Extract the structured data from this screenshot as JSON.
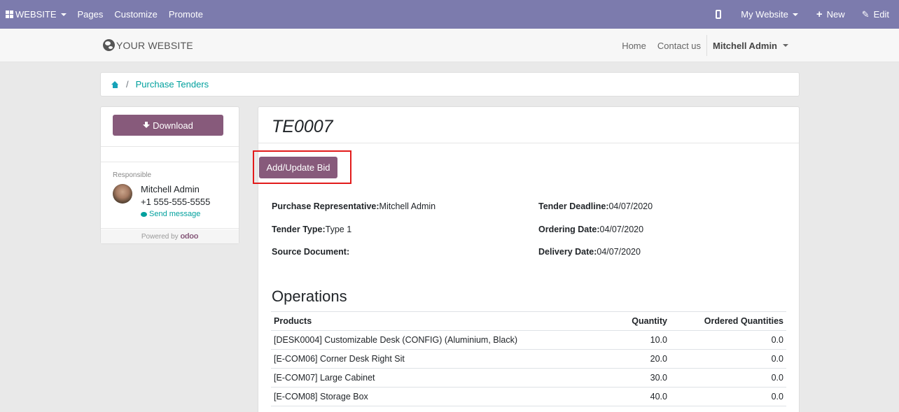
{
  "topbar": {
    "website_menu": "WEBSITE",
    "pages": "Pages",
    "customize": "Customize",
    "promote": "Promote",
    "website_selector": "My Website",
    "new": "New",
    "edit": "Edit"
  },
  "header": {
    "logo_text": "YOUR WEBSITE",
    "nav": [
      "Home",
      "Contact us"
    ],
    "user": "Mitchell Admin"
  },
  "breadcrumb": {
    "separator": "/",
    "current": "Purchase Tenders"
  },
  "sidebar": {
    "download": "Download",
    "responsible_label": "Responsible",
    "responsible_name": "Mitchell Admin",
    "responsible_phone": "+1 555-555-5555",
    "send_message": "Send message",
    "powered_by": "Powered by",
    "odoo": "odoo"
  },
  "tender": {
    "title": "TE0007",
    "bid_button": "Add/Update Bid",
    "fields": {
      "purchase_rep_label": "Purchase Representative:",
      "purchase_rep_value": "Mitchell Admin",
      "tender_type_label": "Tender Type:",
      "tender_type_value": "Type 1",
      "source_doc_label": "Source Document:",
      "source_doc_value": "",
      "deadline_label": "Tender Deadline:",
      "deadline_value": "04/07/2020",
      "ordering_label": "Ordering Date:",
      "ordering_value": "04/07/2020",
      "delivery_label": "Delivery Date:",
      "delivery_value": "04/07/2020"
    }
  },
  "operations": {
    "title": "Operations",
    "columns": [
      "Products",
      "Quantity",
      "Ordered Quantities"
    ],
    "rows": [
      [
        "[DESK0004] Customizable Desk (CONFIG) (Aluminium, Black)",
        "10.0",
        "0.0"
      ],
      [
        "[E-COM06] Corner Desk Right Sit",
        "20.0",
        "0.0"
      ],
      [
        "[E-COM07] Large Cabinet",
        "30.0",
        "0.0"
      ],
      [
        "[E-COM08] Storage Box",
        "40.0",
        "0.0"
      ]
    ]
  },
  "colors": {
    "topbar": "#7c7bad",
    "primary_button": "#875a7b",
    "link": "#00a09d",
    "highlight_box": "#e21b1b"
  }
}
